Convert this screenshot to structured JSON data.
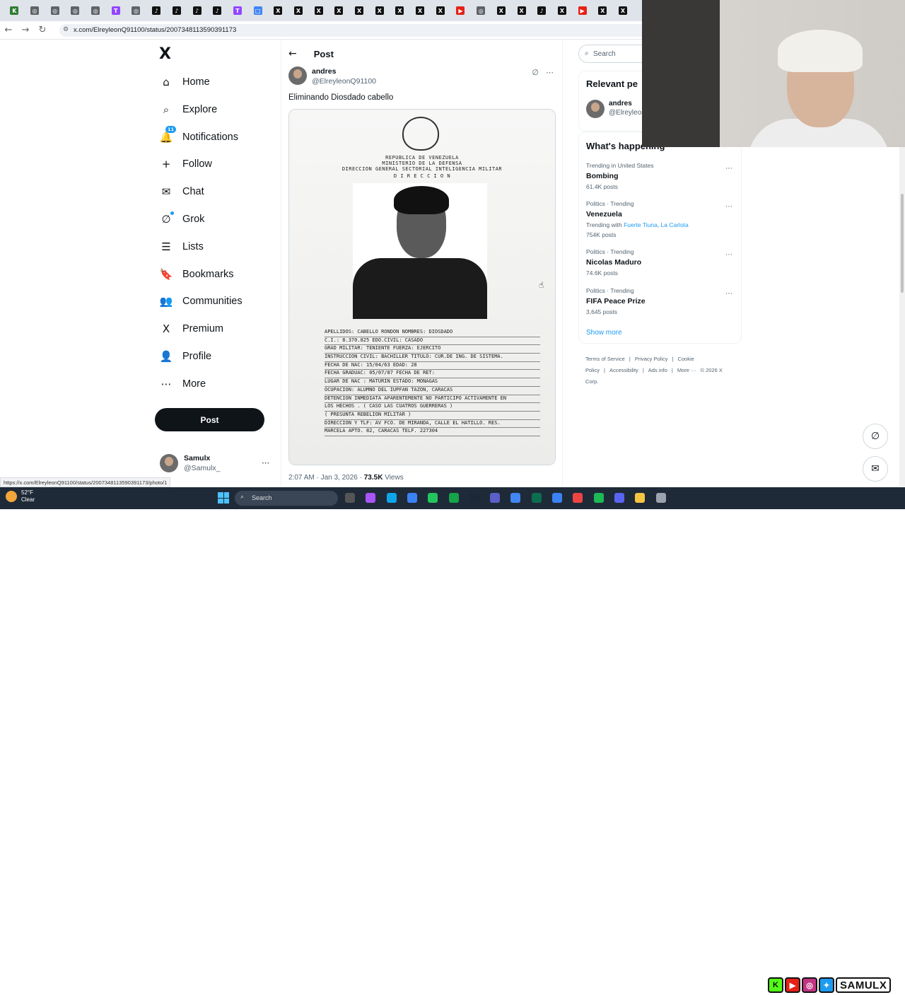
{
  "browser": {
    "url": "x.com/ElreyleonQ91100/status/2007348113590391173",
    "status_url": "https://x.com/ElreyleonQ91100/status/2007348113590391173/photo/1",
    "tab_favicons": [
      "K",
      "◎",
      "◎",
      "◎",
      "◎",
      "T",
      "◎",
      "♪",
      "♪",
      "♪",
      "♪",
      "T",
      "□",
      "X",
      "X",
      "X",
      "X",
      "X",
      "X",
      "X",
      "X",
      "X",
      "▶",
      "◎",
      "X",
      "X",
      "♪",
      "X",
      "▶",
      "X",
      "X"
    ]
  },
  "nav": {
    "logo": "X",
    "items": [
      {
        "label": "Home",
        "icon": "⌂"
      },
      {
        "label": "Explore",
        "icon": "⌕"
      },
      {
        "label": "Notifications",
        "icon": "🔔",
        "badge": "11"
      },
      {
        "label": "Follow",
        "icon": "+"
      },
      {
        "label": "Chat",
        "icon": "✉"
      },
      {
        "label": "Grok",
        "icon": "∅"
      },
      {
        "label": "Lists",
        "icon": "☰"
      },
      {
        "label": "Bookmarks",
        "icon": "🔖"
      },
      {
        "label": "Communities",
        "icon": "👥"
      },
      {
        "label": "Premium",
        "icon": "X"
      },
      {
        "label": "Profile",
        "icon": "👤"
      },
      {
        "label": "More",
        "icon": "⋯"
      }
    ],
    "post_button": "Post",
    "account": {
      "name": "Samulx",
      "handle": "@Samulx_",
      "more": "⋯"
    }
  },
  "post": {
    "header_title": "Post",
    "author_name": "andres",
    "author_handle": "@ElreyleonQ91100",
    "text": "Eliminando Diosdado cabello",
    "document": {
      "header_lines": [
        "REPUBLICA DE VENEZUELA",
        "MINISTERIO DE LA DEFENSA",
        "DIRECCION GENERAL SECTORIAL INTELIGENCIA MILITAR",
        "D I R E C C I O N"
      ],
      "fields": [
        "APELLIDOS: CABELLO RONDON     NOMBRES: DIOSDADO",
        "C.I.:    8.370.825        EDO.CIVIL:   CASADO",
        "GRAD MILITAR:  TENIENTE        FUERZA:   EJERCITO",
        "INSTRUCCION CIVIL: BACHILLER  TITULO: CUR.DE ING. DE SISTEMA.",
        "FECHA DE NAC: 15/04/63           EDAD:  28",
        "FECHA GRADUAC:  05/07/87      FECHA DE RET:",
        "LUGAR DE NAC :   MATURIN        ESTADO:  MONAGAS",
        "OCUPACION:  ALUMNO DEL IUPFAN TAZON, CARACAS",
        "DETENCION INMEDIATA APARENTEMENTE NO PARTICIPO ACTIVAMENTE  EN",
        "LOS HECHOS . ( CASO LAS CUATROS GUERRERAS )",
        "        ( PRESUNTA REBELION MILITAR )",
        "DIRECCION Y  TLF: AV  FCO. DE  MIRANDA, CALLE  EL HATILLO.  RES.",
        "MARCELA APTO. 82, CARACAS TELF. 227304"
      ]
    },
    "time": "2:07 AM · Jan 3, 2026 · ",
    "views_count": "73.5K",
    "views_label": " Views"
  },
  "right": {
    "search_placeholder": "Search",
    "relevant_title": "Relevant pe",
    "relevant_person": {
      "name": "andres",
      "handle": "@Elreyleon"
    },
    "happening_title": "What's happening",
    "trends": [
      {
        "category": "Trending in United States",
        "name": "Bombing",
        "posts": "61.4K posts"
      },
      {
        "category": "Politics · Trending",
        "name": "Venezuela",
        "with_label": "Trending with ",
        "with_links": [
          "Fuerte Tiuna",
          "La Carlota"
        ],
        "posts": "754K posts"
      },
      {
        "category": "Politics · Trending",
        "name": "Nicolas Maduro",
        "posts": "74.6K posts"
      },
      {
        "category": "Politics · Trending",
        "name": "FIFA Peace Prize",
        "posts": "3,645 posts"
      }
    ],
    "show_more": "Show more",
    "footer": [
      "Terms of Service",
      "|",
      "Privacy Policy",
      "|",
      "Cookie Policy",
      "|",
      "Accessibility",
      "|",
      "Ads info",
      "|",
      "More ···",
      "© 2026 X Corp."
    ]
  },
  "taskbar": {
    "temp": "52°F",
    "condition": "Clear",
    "search": "Search",
    "overlay_brand": "SAMULX"
  },
  "colors": {
    "accent": "#1d9bf0",
    "text": "#0f1419",
    "muted": "#536471",
    "taskbar": "#1f2a38"
  }
}
